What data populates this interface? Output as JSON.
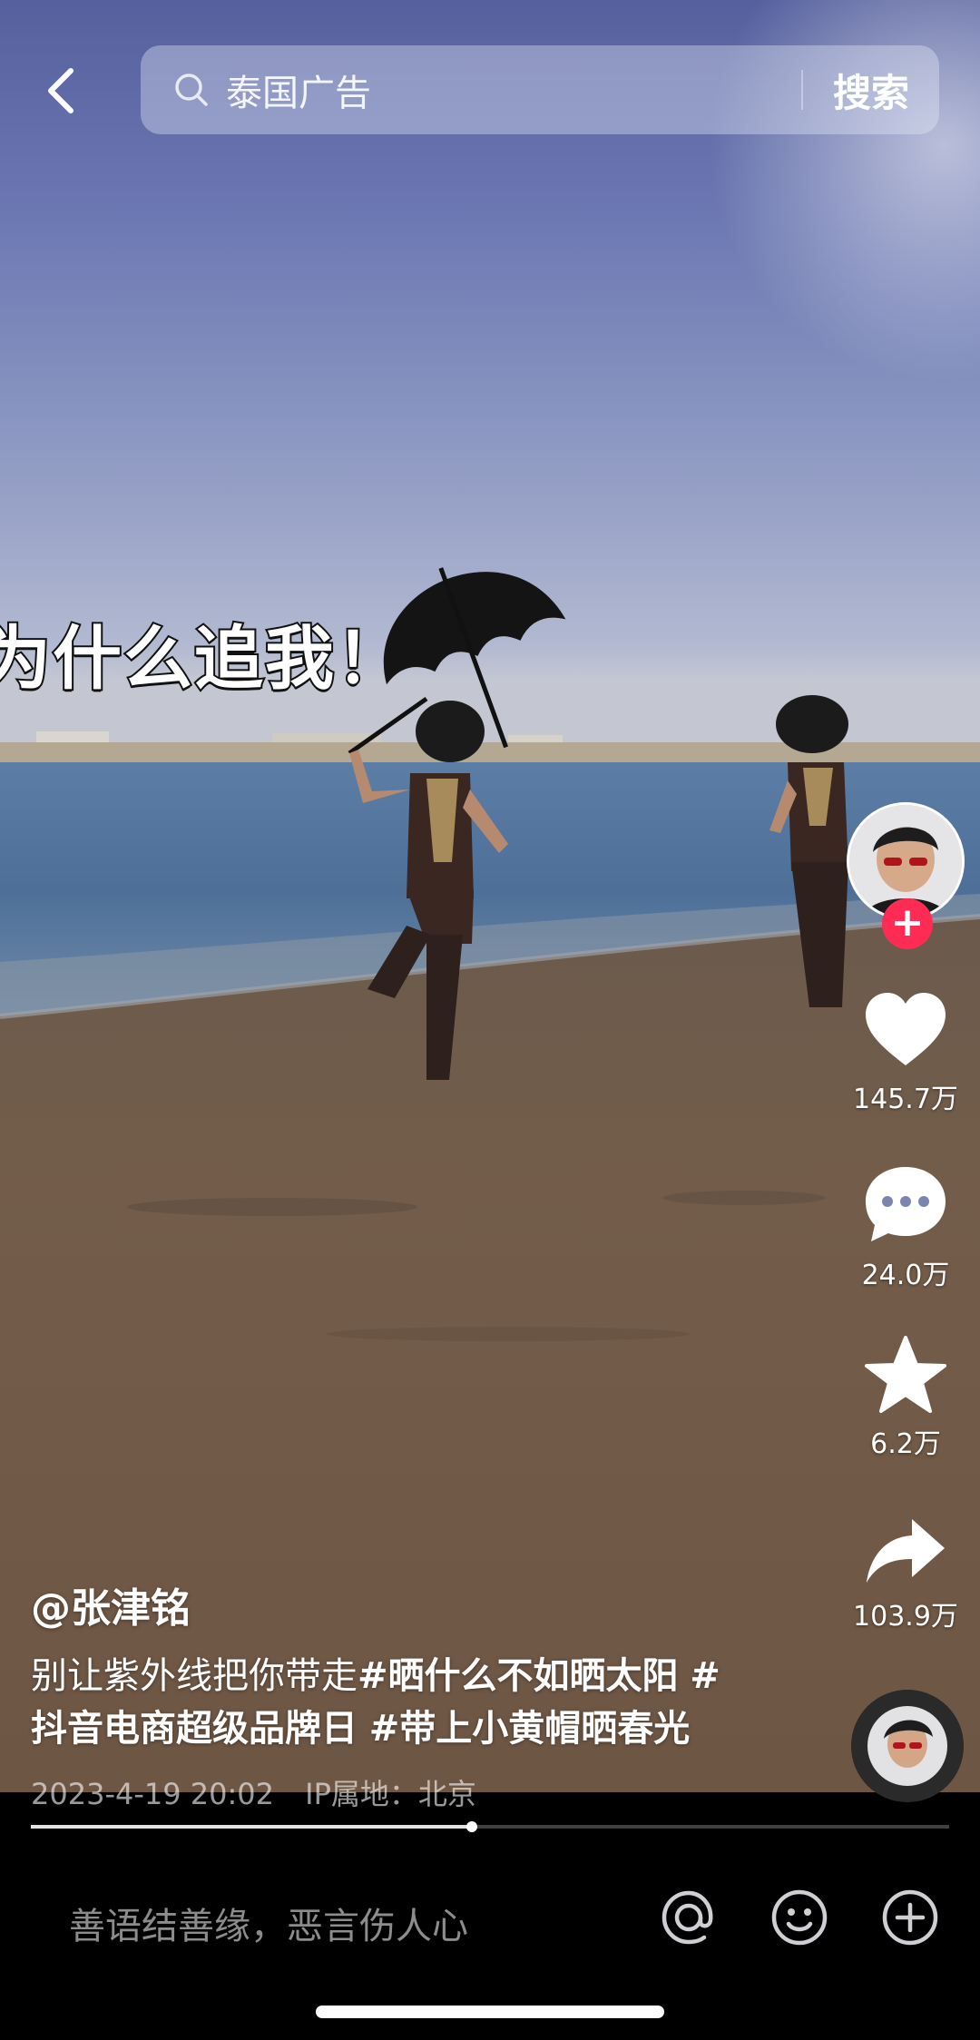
{
  "search": {
    "query": "泰国广告",
    "button_label": "搜索"
  },
  "video": {
    "overlay_caption": "为什么追我！"
  },
  "actions": {
    "likes": "145.7万",
    "comments": "24.0万",
    "favorites": "6.2万",
    "shares": "103.9万"
  },
  "post": {
    "author": "@张津铭",
    "description_line1": "别让紫外线把你带走",
    "tag1": "#晒什么不如晒太阳",
    "tag2_prefix": "#",
    "description_line2": "抖音电商超级品牌日",
    "tag3": "#带上小黄帽晒春光",
    "date": "2023-4-19 20:02",
    "ip_location": "IP属地：北京"
  },
  "playback": {
    "progress_fraction": 0.48
  },
  "bottom_bar": {
    "comment_placeholder": "善语结善缘，恶言伤人心"
  },
  "colors": {
    "follow_accent": "#fe2c55"
  },
  "icons": [
    "back-icon",
    "search-icon",
    "heart-icon",
    "comment-icon",
    "star-icon",
    "share-icon",
    "at-icon",
    "emoji-icon",
    "plus-circle-icon"
  ]
}
